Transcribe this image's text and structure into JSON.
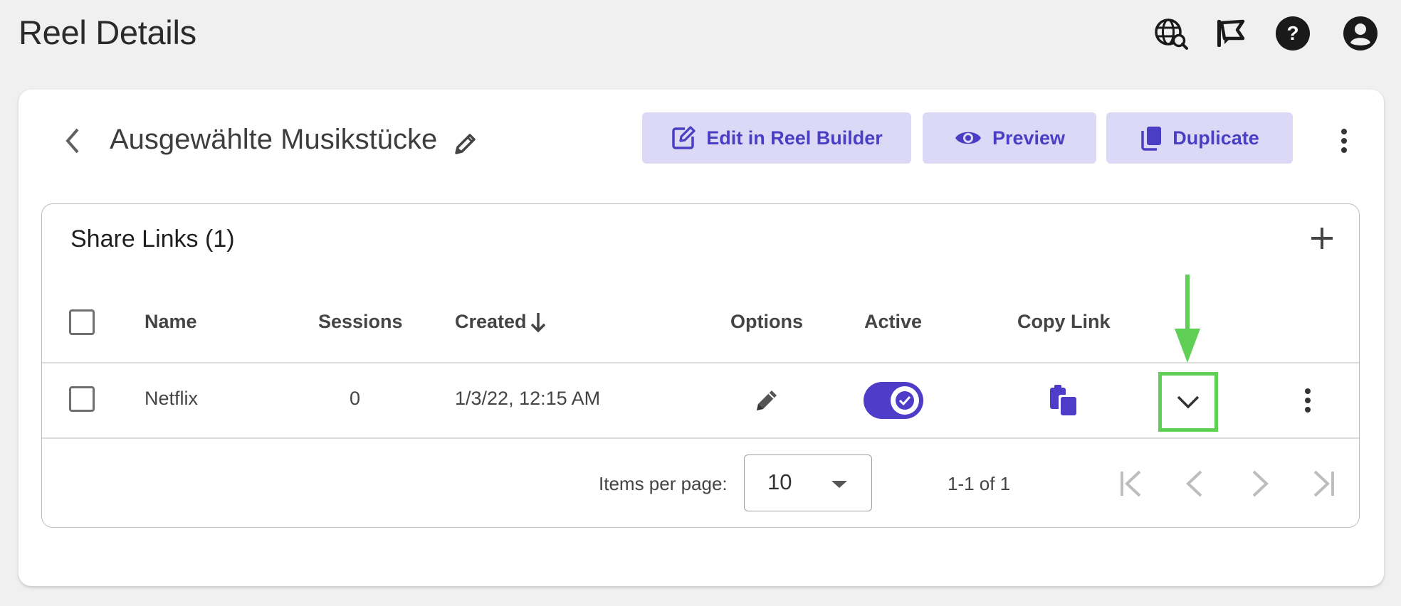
{
  "header": {
    "title": "Reel Details",
    "icons": [
      "web-search-icon",
      "announcement-flag-icon",
      "help-icon",
      "account-icon"
    ]
  },
  "reel": {
    "name": "Ausgewählte Musikstücke",
    "actions": {
      "edit": "Edit in Reel Builder",
      "preview": "Preview",
      "duplicate": "Duplicate"
    }
  },
  "share_links": {
    "title": "Share Links (1)",
    "columns": {
      "name": "Name",
      "sessions": "Sessions",
      "created": "Created",
      "options": "Options",
      "active": "Active",
      "copy_link": "Copy Link"
    },
    "rows": [
      {
        "name": "Netflix",
        "sessions": "0",
        "created": "1/3/22, 12:15 AM",
        "active": true
      }
    ]
  },
  "pagination": {
    "items_per_page_label": "Items per page:",
    "items_per_page_value": "10",
    "range": "1-1 of 1"
  },
  "colors": {
    "accent": "#4f3cc9",
    "button_bg": "#dcd9f7",
    "annotation": "#5fd055"
  }
}
